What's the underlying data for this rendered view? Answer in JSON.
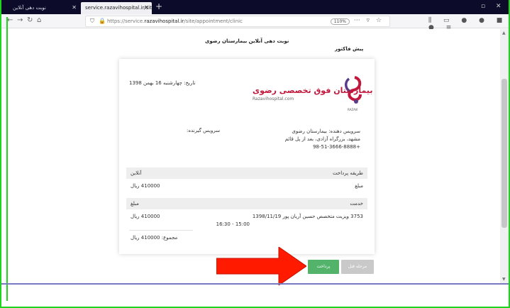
{
  "browser": {
    "tabs": [
      {
        "label": "نوبت دهی آنلاین",
        "active": false
      },
      {
        "label": "service.razavihospital.ir/site/appoin",
        "active": true
      }
    ],
    "url_prefix": "https://service.",
    "url_domain": "razavihospital.ir",
    "url_path": "/site/appointment/clinic",
    "zoom": "110%"
  },
  "page": {
    "title": "نوبت دهی آنلاین بیمارستان رضوی",
    "section": "پیش فاکتور"
  },
  "invoice": {
    "date": "تاریخ: چهارشنبه 16 بهمن 1398",
    "logo_name": "بیمارستان فوق تخصصی رضوی",
    "logo_site": "Razavihospital.com",
    "logo_sub": "RAZAVI",
    "provider_line1": "سرویس دهنده: بیمارستان رضوی",
    "provider_line2": "مشهد، بزرگراه آزادی، بعد از پل قائم",
    "provider_line3": "+98-51-3666-8888",
    "receiver": "سرویس گیرنده:",
    "payment_head": "طریقه پرداخت",
    "payment_method": "آنلاین",
    "amount_label": "مبلغ",
    "amount_value": "410000 ریال",
    "service_head": "خدمت",
    "service_amount_head": "مبلغ",
    "service_desc": "3753 ویزیت متخصص حسین آریان پور 1398/11/19",
    "service_time": "15:00 - 16:30",
    "service_amount": "410000 ریال",
    "total": "مجموع: 410000 ریال"
  },
  "buttons": {
    "pay": "پرداخت",
    "prev": "مرحله قبل"
  },
  "colors": {
    "pay_button": "#53b36b",
    "prev_button": "#c9c9c9",
    "arrow": "#ff1a00",
    "logo": "#c2183c",
    "frame": "#1fd41f"
  }
}
